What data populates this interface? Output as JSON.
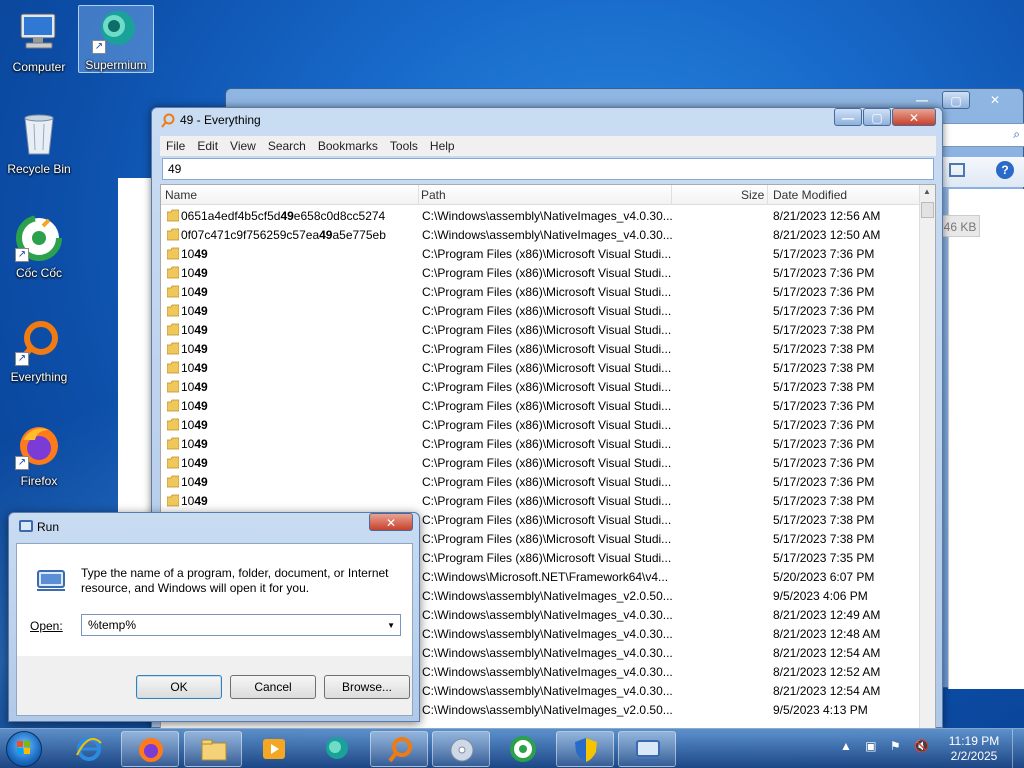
{
  "desktop": {
    "icons": [
      {
        "label": "Computer",
        "icon": "computer-icon"
      },
      {
        "label": "Supermium",
        "icon": "supermium-icon",
        "selected": true
      },
      {
        "label": "Recycle Bin",
        "icon": "recycle-bin-icon"
      },
      {
        "label": "Cốc Cốc",
        "icon": "coccoc-icon"
      },
      {
        "label": "Everything",
        "icon": "everything-icon"
      },
      {
        "label": "Firefox",
        "icon": "firefox-icon"
      }
    ]
  },
  "background_window": {
    "size_badge": "46 KB"
  },
  "everything": {
    "title": "49 - Everything",
    "menu": [
      "File",
      "Edit",
      "View",
      "Search",
      "Bookmarks",
      "Tools",
      "Help"
    ],
    "search_value": "49",
    "columns": {
      "name": "Name",
      "path": "Path",
      "size": "Size",
      "date": "Date Modified"
    },
    "rows": [
      {
        "pre": "0651a4edf4b5cf5d",
        "hl": "49",
        "post": "e658c0d8cc5274",
        "path": "C:\\Windows\\assembly\\NativeImages_v4.0.30...",
        "date": "8/21/2023 12:56 AM"
      },
      {
        "pre": "0f07c471c9f756259c57ea",
        "hl": "49",
        "post": "a5e775eb",
        "path": "C:\\Windows\\assembly\\NativeImages_v4.0.30...",
        "date": "8/21/2023 12:50 AM"
      },
      {
        "pre": "10",
        "hl": "49",
        "post": "",
        "path": "C:\\Program Files (x86)\\Microsoft Visual Studi...",
        "date": "5/17/2023 7:36 PM"
      },
      {
        "pre": "10",
        "hl": "49",
        "post": "",
        "path": "C:\\Program Files (x86)\\Microsoft Visual Studi...",
        "date": "5/17/2023 7:36 PM"
      },
      {
        "pre": "10",
        "hl": "49",
        "post": "",
        "path": "C:\\Program Files (x86)\\Microsoft Visual Studi...",
        "date": "5/17/2023 7:36 PM"
      },
      {
        "pre": "10",
        "hl": "49",
        "post": "",
        "path": "C:\\Program Files (x86)\\Microsoft Visual Studi...",
        "date": "5/17/2023 7:36 PM"
      },
      {
        "pre": "10",
        "hl": "49",
        "post": "",
        "path": "C:\\Program Files (x86)\\Microsoft Visual Studi...",
        "date": "5/17/2023 7:38 PM"
      },
      {
        "pre": "10",
        "hl": "49",
        "post": "",
        "path": "C:\\Program Files (x86)\\Microsoft Visual Studi...",
        "date": "5/17/2023 7:38 PM"
      },
      {
        "pre": "10",
        "hl": "49",
        "post": "",
        "path": "C:\\Program Files (x86)\\Microsoft Visual Studi...",
        "date": "5/17/2023 7:38 PM"
      },
      {
        "pre": "10",
        "hl": "49",
        "post": "",
        "path": "C:\\Program Files (x86)\\Microsoft Visual Studi...",
        "date": "5/17/2023 7:38 PM"
      },
      {
        "pre": "10",
        "hl": "49",
        "post": "",
        "path": "C:\\Program Files (x86)\\Microsoft Visual Studi...",
        "date": "5/17/2023 7:36 PM"
      },
      {
        "pre": "10",
        "hl": "49",
        "post": "",
        "path": "C:\\Program Files (x86)\\Microsoft Visual Studi...",
        "date": "5/17/2023 7:36 PM"
      },
      {
        "pre": "10",
        "hl": "49",
        "post": "",
        "path": "C:\\Program Files (x86)\\Microsoft Visual Studi...",
        "date": "5/17/2023 7:36 PM"
      },
      {
        "pre": "10",
        "hl": "49",
        "post": "",
        "path": "C:\\Program Files (x86)\\Microsoft Visual Studi...",
        "date": "5/17/2023 7:36 PM"
      },
      {
        "pre": "10",
        "hl": "49",
        "post": "",
        "path": "C:\\Program Files (x86)\\Microsoft Visual Studi...",
        "date": "5/17/2023 7:36 PM"
      },
      {
        "pre": "10",
        "hl": "49",
        "post": "",
        "path": "C:\\Program Files (x86)\\Microsoft Visual Studi...",
        "date": "5/17/2023 7:38 PM"
      },
      {
        "pre": "",
        "hl": "",
        "post": "",
        "path": "C:\\Program Files (x86)\\Microsoft Visual Studi...",
        "date": "5/17/2023 7:38 PM"
      },
      {
        "pre": "",
        "hl": "",
        "post": "",
        "path": "C:\\Program Files (x86)\\Microsoft Visual Studi...",
        "date": "5/17/2023 7:38 PM"
      },
      {
        "pre": "",
        "hl": "",
        "post": "",
        "path": "C:\\Program Files (x86)\\Microsoft Visual Studi...",
        "date": "5/17/2023 7:35 PM"
      },
      {
        "pre": "",
        "hl": "",
        "post": "",
        "path": "C:\\Windows\\Microsoft.NET\\Framework64\\v4...",
        "date": "5/20/2023 6:07 PM"
      },
      {
        "pre": "",
        "hl": "",
        "post": "",
        "path": "C:\\Windows\\assembly\\NativeImages_v2.0.50...",
        "date": "9/5/2023 4:06 PM"
      },
      {
        "pre": "",
        "hl": "",
        "post": "",
        "path": "C:\\Windows\\assembly\\NativeImages_v4.0.30...",
        "date": "8/21/2023 12:49 AM"
      },
      {
        "pre": "",
        "hl": "",
        "post": "",
        "path": "C:\\Windows\\assembly\\NativeImages_v4.0.30...",
        "date": "8/21/2023 12:48 AM"
      },
      {
        "pre": "",
        "hl": "",
        "post": "",
        "path": "C:\\Windows\\assembly\\NativeImages_v4.0.30...",
        "date": "8/21/2023 12:54 AM"
      },
      {
        "pre": "",
        "hl": "",
        "post": "",
        "path": "C:\\Windows\\assembly\\NativeImages_v4.0.30...",
        "date": "8/21/2023 12:52 AM"
      },
      {
        "pre": "",
        "hl": "",
        "post": "",
        "path": "C:\\Windows\\assembly\\NativeImages_v4.0.30...",
        "date": "8/21/2023 12:54 AM"
      },
      {
        "pre": "",
        "hl": "",
        "post": "",
        "path": "C:\\Windows\\assembly\\NativeImages_v2.0.50...",
        "date": "9/5/2023 4:13 PM"
      }
    ]
  },
  "run_dialog": {
    "title": "Run",
    "description": "Type the name of a program, folder, document, or Internet resource, and Windows will open it for you.",
    "open_label": "Open:",
    "open_value": "%temp%",
    "ok_label": "OK",
    "cancel_label": "Cancel",
    "browse_label": "Browse..."
  },
  "taskbar": {
    "items": [
      "ie-icon",
      "firefox-icon",
      "explorer-icon",
      "media-player-icon",
      "supermium-icon",
      "everything-icon",
      "disc-icon",
      "coccoc-icon",
      "uac-shield-icon",
      "run-icon"
    ],
    "clock_time": "11:19 PM",
    "clock_date": "2/2/2025"
  },
  "colors": {
    "title_bar": "#c9dcf2",
    "close_red": "#c7412b",
    "taskbar": "#1e4682"
  }
}
